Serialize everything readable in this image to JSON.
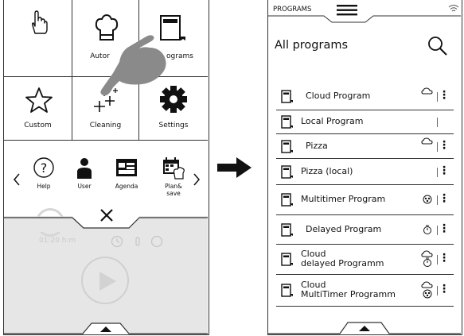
{
  "left": {
    "tiles": [
      {
        "label": "",
        "icon": "hand-touch-icon"
      },
      {
        "label": "Autor",
        "icon": "chef-hat-icon"
      },
      {
        "label": "ograms",
        "icon": "program-book-icon"
      },
      {
        "label": "Custom",
        "icon": "star-icon"
      },
      {
        "label": "Cleaning",
        "icon": "sparkle-icon"
      },
      {
        "label": "Settings",
        "icon": "gear-icon"
      }
    ],
    "quick": [
      {
        "label": "Help",
        "icon": "question-circle-icon"
      },
      {
        "label": "User",
        "icon": "user-icon"
      },
      {
        "label": "Agenda",
        "icon": "agenda-icon"
      },
      {
        "label": "Plan&\nsave",
        "icon": "plan-save-icon"
      }
    ],
    "faded_time": "01:20 h:m",
    "faded_temp": "00"
  },
  "right": {
    "status_title": "PROGRAMS",
    "page_title": "All programs",
    "programs": [
      {
        "name": "Cloud Program",
        "icon": "cloud-icon"
      },
      {
        "name": "Local Program",
        "icon": ""
      },
      {
        "name": "Pizza",
        "icon": "cloud-icon"
      },
      {
        "name": "Pizza (local)",
        "icon": ""
      },
      {
        "name": "Multitimer Program",
        "icon": "multitimer-icon"
      },
      {
        "name": "Delayed Program",
        "icon": "delayed-icon"
      },
      {
        "name": "Cloud\ndelayed Programm",
        "icon": "cloud-delayed-icon"
      },
      {
        "name": "Cloud\nMultiTimer Programm",
        "icon": "cloud-multitimer-icon"
      }
    ]
  },
  "colors": {
    "line": "#333333",
    "hand": "#8a8a8a",
    "faded": "#e6e6e6"
  }
}
